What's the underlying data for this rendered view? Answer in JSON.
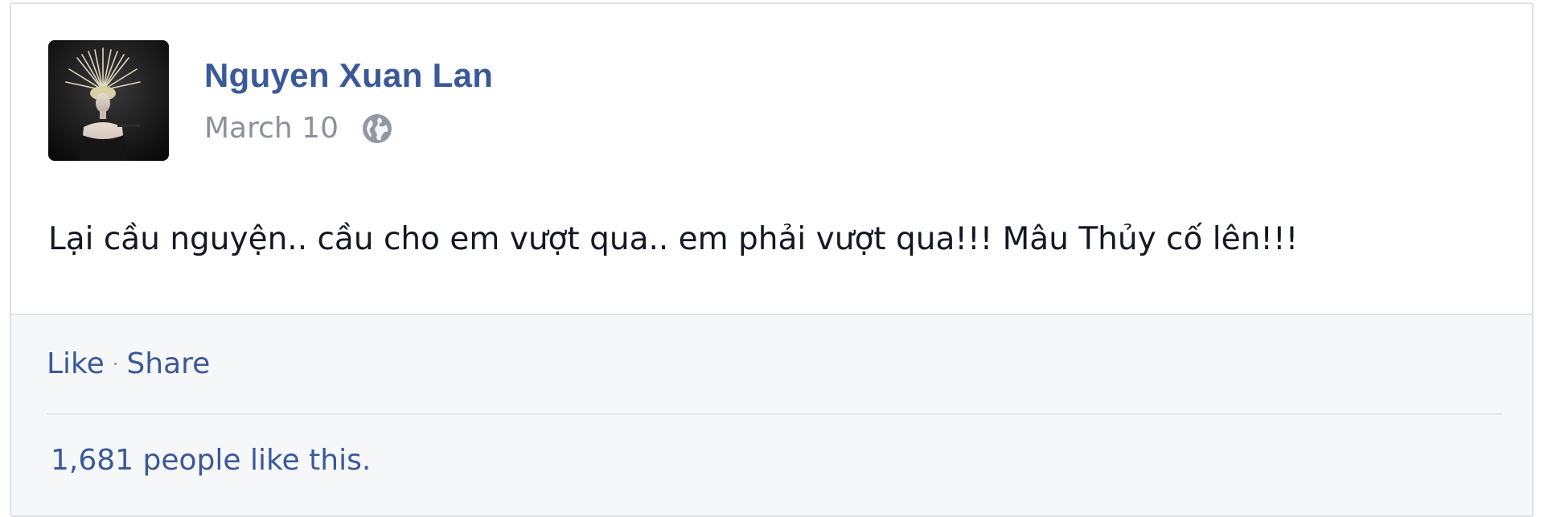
{
  "post": {
    "author": {
      "name": "Nguyen Xuan Lan",
      "avatar_icon": "profile-photo"
    },
    "meta": {
      "date": "March 10",
      "privacy_icon": "globe-icon"
    },
    "text": "Lại cầu nguyện.. cầu cho em vượt qua.. em phải vượt qua!!! Mâu Thủy cố lên!!!"
  },
  "actions": {
    "like_label": "Like",
    "separator": "·",
    "share_label": "Share"
  },
  "likes": {
    "summary": "1,681 people like this."
  },
  "colors": {
    "link": "#3b5998",
    "meta_text": "#8c919b",
    "body_text": "#141823",
    "footer_bg": "#f6f7f9"
  }
}
